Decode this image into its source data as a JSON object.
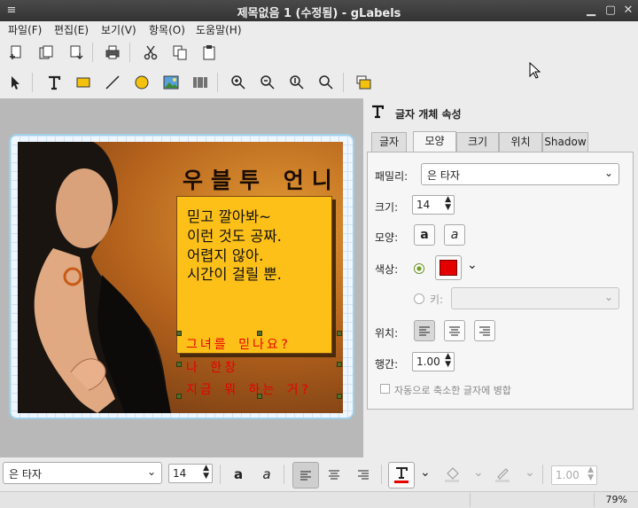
{
  "window": {
    "title": "제목없음 1 (수정됨) - gLabels"
  },
  "menu": [
    "파일(F)",
    "편집(E)",
    "보기(V)",
    "항목(O)",
    "도움말(H)"
  ],
  "label": {
    "title": "우블투 언니",
    "box_lines": [
      "믿고 깔아봐~",
      "이런 것도 공짜.",
      "어렵지 않아.",
      "시간이 걸릴 뿐."
    ],
    "red_lines": [
      "그녀를 믿나요?",
      "나 한창",
      "지금 뭐 하는 거?"
    ]
  },
  "panel": {
    "header": "글자 개체 속성",
    "tabs": [
      "글자",
      "모양",
      "크기",
      "위치",
      "Shadow"
    ],
    "family_label": "패밀리:",
    "family_value": "은 타자",
    "size_label": "크기:",
    "size_value": "14",
    "style_label": "모양:",
    "color_label": "색상:",
    "key_label": "키:",
    "align_label": "위치:",
    "spacing_label": "행간:",
    "spacing_value": "1.00",
    "autoshrink_label": "자동으로 축소한 글자에 병합"
  },
  "bottom": {
    "font": "은 타자",
    "size": "14",
    "spacing": "1.00"
  },
  "status": {
    "zoom": "79%"
  },
  "colors": {
    "accent": "#e50000",
    "label_bg": "#eef6ff"
  }
}
